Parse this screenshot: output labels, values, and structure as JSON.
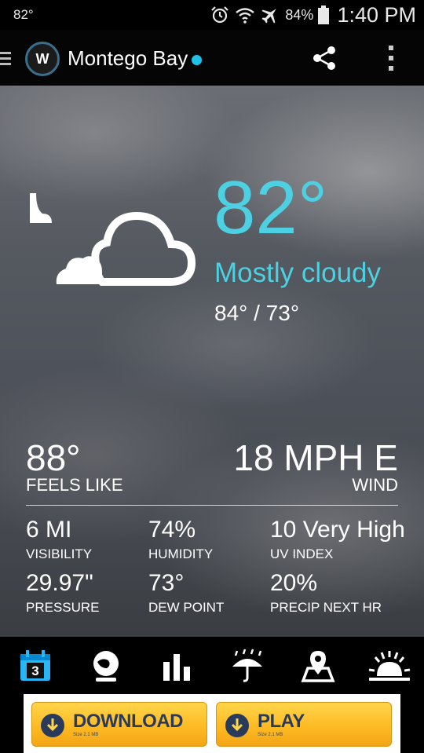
{
  "status_bar": {
    "temperature": "82°",
    "battery": "84%",
    "time": "1:40 PM"
  },
  "app_bar": {
    "logo_text": "W",
    "city": "Montego Bay"
  },
  "current": {
    "temperature": "82°",
    "condition": "Mostly cloudy",
    "hi_lo": "84° / 73°",
    "accent_color": "#4dd0e1",
    "icon": "partly-cloudy-night-icon"
  },
  "feels_like": {
    "value": "88°",
    "label": "FEELS LIKE"
  },
  "wind": {
    "value": "18 MPH E",
    "label": "WIND"
  },
  "stats": [
    {
      "value": "6 MI",
      "label": "VISIBILITY"
    },
    {
      "value": "74%",
      "label": "HUMIDITY"
    },
    {
      "value": "10 Very High",
      "label": "UV INDEX"
    },
    {
      "value": "29.97\"",
      "label": "PRESSURE"
    },
    {
      "value": "73°",
      "label": "DEW POINT"
    },
    {
      "value": "20%",
      "label": "PRECIP NEXT HR"
    }
  ],
  "bottom_nav": {
    "calendar_day": "3",
    "items": [
      "calendar-icon",
      "globe-icon",
      "bar-chart-icon",
      "umbrella-rain-icon",
      "map-pin-icon",
      "sunrise-icon"
    ]
  },
  "ad": {
    "download_label": "DOWNLOAD",
    "download_sub": "Size 2.1 MB",
    "play_label": "PLAY",
    "play_sub": "Size 2.1 MB"
  }
}
